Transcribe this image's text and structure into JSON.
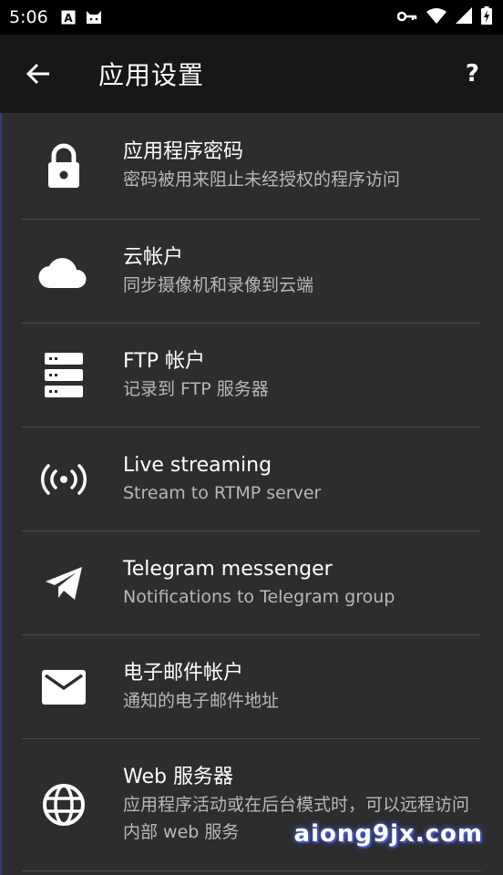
{
  "status_bar": {
    "time": "5:06",
    "icons_left": [
      "a-box-icon",
      "cat-icon"
    ],
    "icons_right": [
      "key-icon",
      "wifi-icon",
      "signal-icon",
      "battery-charging-icon"
    ]
  },
  "app_bar": {
    "title": "应用设置",
    "help_label": "?"
  },
  "items": [
    {
      "title": "应用程序密码",
      "subtitle": "密码被用来阻止未经授权的程序访问",
      "icon": "lock-icon"
    },
    {
      "title": "云帐户",
      "subtitle": "同步摄像机和录像到云端",
      "icon": "cloud-icon"
    },
    {
      "title": "FTP 帐户",
      "subtitle": "记录到 FTP 服务器",
      "icon": "server-icon"
    },
    {
      "title": "Live streaming",
      "subtitle": "Stream to RTMP server",
      "icon": "broadcast-icon"
    },
    {
      "title": "Telegram messenger",
      "subtitle": "Notifications to Telegram group",
      "icon": "send-icon"
    },
    {
      "title": "电子邮件帐户",
      "subtitle": "通知的电子邮件地址",
      "icon": "mail-icon"
    },
    {
      "title": "Web 服务器",
      "subtitle": "应用程序活动或在后台模式时，可以远程访问内部 web 服务",
      "icon": "globe-icon"
    }
  ],
  "watermark": "aiong9jx.com"
}
